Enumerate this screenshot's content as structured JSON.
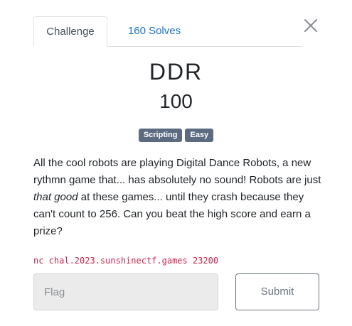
{
  "tabs": {
    "challenge_label": "Challenge",
    "solves_label": "160 Solves"
  },
  "challenge": {
    "name": "DDR",
    "points": "100",
    "tags": [
      "Scripting",
      "Easy"
    ],
    "description": {
      "part1": "All the cool robots are playing Digital Dance Robots, a new rythmn game that... has absolutely no sound! Robots are just ",
      "emphasis": "that good",
      "part2": " at these games... until they crash because they can't count to 256. Can you beat the high score and earn a prize?"
    },
    "connection": "nc chal.2023.sunshinectf.games 23200"
  },
  "form": {
    "flag_placeholder": "Flag",
    "flag_value": "",
    "submit_label": "Submit"
  },
  "icons": {
    "close": "close-icon"
  },
  "colors": {
    "link": "#1a73c9",
    "tag_bg": "#5c6b80",
    "code": "#c7254e",
    "input_bg": "#ebebeb"
  }
}
